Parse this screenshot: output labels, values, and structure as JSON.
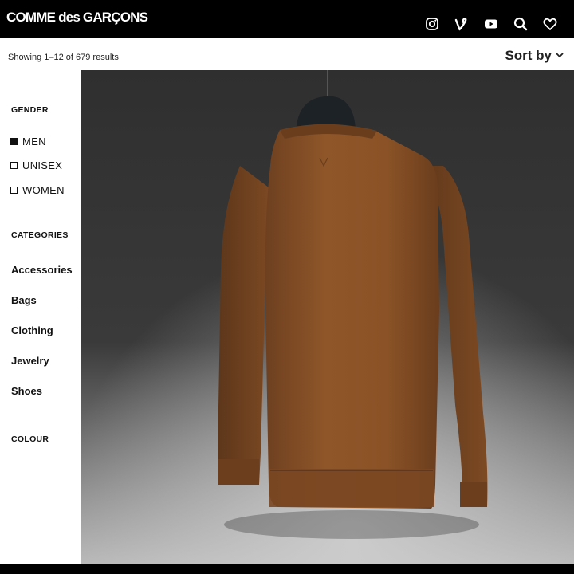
{
  "header": {
    "logo_text": "COMME des GARÇONS",
    "icons": [
      "instagram-icon",
      "vine-icon",
      "youtube-icon",
      "search-icon",
      "heart-icon"
    ]
  },
  "results": {
    "count_text": "Showing 1–12 of 679 results",
    "sort_label": "Sort by"
  },
  "sidebar": {
    "gender_heading": "GENDER",
    "gender_items": [
      {
        "label": "MEN",
        "checked": true
      },
      {
        "label": "UNISEX",
        "checked": false
      },
      {
        "label": "WOMEN",
        "checked": false
      }
    ],
    "categories_heading": "CATEGORIES",
    "categories": [
      "Accessories",
      "Bags",
      "Clothing",
      "Jewelry",
      "Shoes"
    ],
    "colour_heading": "COLOUR"
  },
  "colors": {
    "topbar": "#000000",
    "sweater": "#8a5228",
    "background_dark": "#2b2b2b"
  }
}
